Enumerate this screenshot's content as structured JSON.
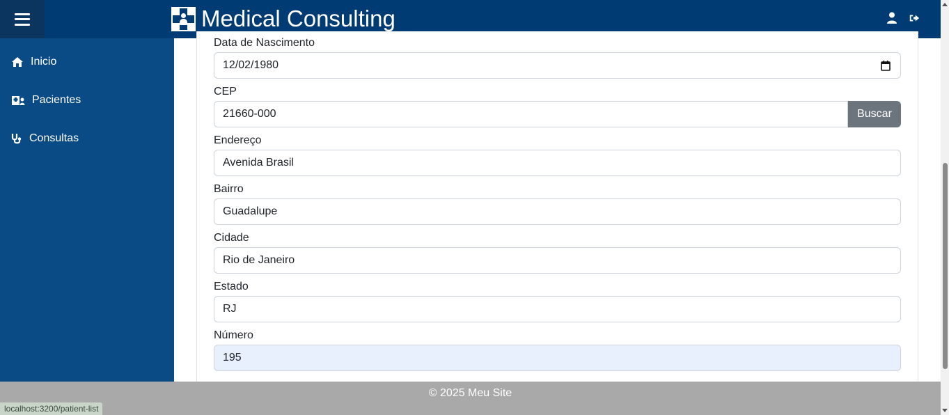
{
  "header": {
    "title": "Medical Consulting",
    "menu_icon": "hamburger-menu-icon",
    "logo_icon": "medical-cross-doctor-icon",
    "user_icon": "user-icon",
    "logout_icon": "sign-out-icon"
  },
  "sidebar": {
    "items": [
      {
        "label": "Inicio",
        "icon": "home-icon"
      },
      {
        "label": "Pacientes",
        "icon": "hospital-user-icon"
      },
      {
        "label": "Consultas",
        "icon": "stethoscope-icon"
      }
    ]
  },
  "form": {
    "birth_date": {
      "label": "Data de Nascimento",
      "value": "12/02/1980"
    },
    "cep": {
      "label": "CEP",
      "value": "21660-000",
      "button": "Buscar"
    },
    "address": {
      "label": "Endereço",
      "value": "Avenida Brasil"
    },
    "district": {
      "label": "Bairro",
      "value": "Guadalupe"
    },
    "city": {
      "label": "Cidade",
      "value": "Rio de Janeiro"
    },
    "state": {
      "label": "Estado",
      "value": "RJ"
    },
    "number": {
      "label": "Número",
      "value": "195"
    }
  },
  "footer": {
    "text": "© 2025 Meu Site"
  },
  "status_bar": {
    "url": "localhost:3200/patient-list"
  },
  "colors": {
    "header": "#003b73",
    "sidebar": "#0a4a85",
    "button": "#6c757d",
    "footer": "#a9a9a9",
    "autofill": "#e8f0fe"
  }
}
